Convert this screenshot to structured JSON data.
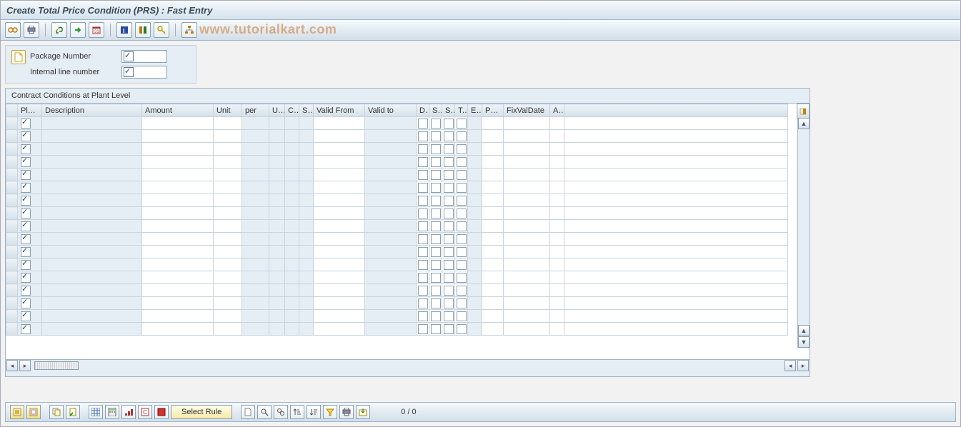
{
  "title": "Create Total Price Condition (PRS) : Fast Entry",
  "watermark": "www.tutorialkart.com",
  "toolbar": {
    "icons": [
      "glasses",
      "print",
      "sep",
      "thumb-up",
      "forward",
      "calendar",
      "sep",
      "info",
      "tools",
      "key",
      "sep",
      "hierarchy"
    ]
  },
  "form": {
    "package_label": "Package Number",
    "internal_line_label": "Internal line number"
  },
  "grid_title": "Contract Conditions at Plant Level",
  "columns": [
    "Plant",
    "Description",
    "Amount",
    "Unit",
    "per",
    "U...",
    "C..",
    "S..",
    "Valid From",
    "Valid to",
    "D..",
    "S..",
    "S..",
    "T..",
    "E..",
    "Pa...",
    "FixValDate",
    "A.."
  ],
  "rows": 17,
  "footer": {
    "select_rule_label": "Select Rule",
    "counter": "0  /  0"
  }
}
